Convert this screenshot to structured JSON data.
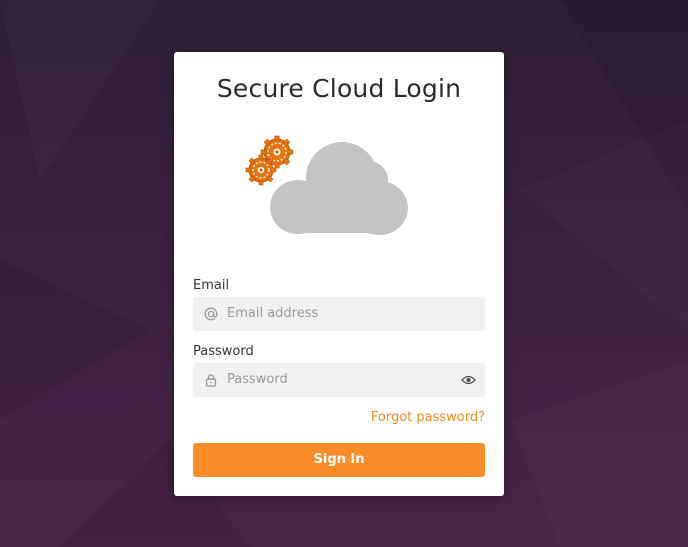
{
  "login_card": {
    "title": "Secure Cloud Login",
    "email_label": "Email",
    "email_placeholder": "Email address",
    "password_label": "Password",
    "password_placeholder": "Password",
    "forgot_password": "Forgot password?",
    "sign_in": "Sign In"
  },
  "icons": {
    "email_field": "at-icon",
    "password_field": "lock-icon",
    "password_toggle": "eye-icon",
    "illustration": "cloud-gears-illustration"
  },
  "colors": {
    "accent": "#fa8c2a",
    "link": "#f28a20",
    "card_bg": "#ffffff",
    "input_bg": "#f1f1f1",
    "cloud": "#c4c4c4",
    "gear": "#e8750f",
    "background": "#3a2240"
  }
}
